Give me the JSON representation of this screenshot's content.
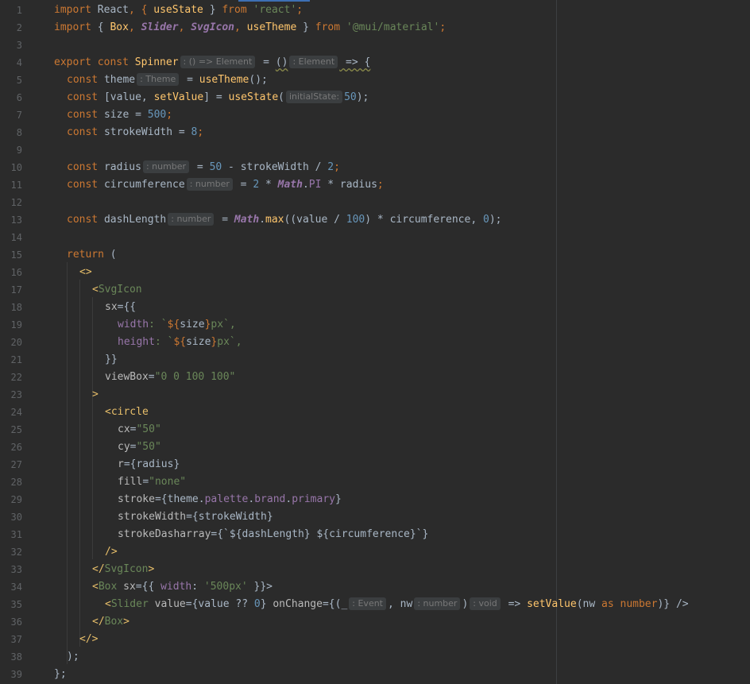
{
  "editor": {
    "language": "tsx",
    "colors": {
      "background": "#2b2b2b",
      "keyword": "#cc7832",
      "function": "#ffc66d",
      "string": "#6a8759",
      "number": "#6897bb",
      "property": "#9876aa",
      "tag": "#e8bf6a",
      "default_text": "#a9b7c6"
    },
    "line_numbers": [
      "1",
      "2",
      "3",
      "4",
      "5",
      "6",
      "7",
      "8",
      "9",
      "10",
      "11",
      "12",
      "13",
      "14",
      "15",
      "16",
      "17",
      "18",
      "19",
      "20",
      "21",
      "22",
      "23",
      "24",
      "25",
      "26",
      "27",
      "28",
      "29",
      "30",
      "31",
      "32",
      "33",
      "34",
      "35",
      "36",
      "37",
      "38",
      "39"
    ],
    "inlay_hints": {
      "spinner_type": ": () => Element",
      "return_type": ": Element",
      "theme_type": ": Theme",
      "initial_state": "initialState:",
      "radius_type": ": number",
      "circumference_type": ": number",
      "dash_type": ": number",
      "event_type": ": Event",
      "nw_type": ": number",
      "void_type": ": void"
    },
    "lines": {
      "l1": {
        "a": "import ",
        "b": "React",
        "c": ", { ",
        "d": "useState",
        "e": " } ",
        "f": "from ",
        "g": "'react'",
        "h": ";"
      },
      "l2": {
        "a": "import ",
        "b": "{ ",
        "c": "Box",
        ",": ", ",
        "d": "Slider",
        "e": "SvgIcon",
        "f": "useTheme",
        "g": " } ",
        "h": "from ",
        "i": "'@mui/material'",
        "j": ";"
      },
      "l4": {
        "a": "export const ",
        "b": "Spinner",
        "c": " = ",
        "d": "()",
        "e": " => {"
      },
      "l5": {
        "a": "const ",
        "b": "theme",
        "c": " = ",
        "d": "useTheme",
        "e": "();"
      },
      "l6": {
        "a": "const ",
        "b": "[value, ",
        "c": "setValue",
        "d": "] = ",
        "e": "useState",
        "f": "(",
        "g": "50",
        "h": ");"
      },
      "l7": {
        "a": "const ",
        "b": "size = ",
        "c": "500",
        "d": ";"
      },
      "l8": {
        "a": "const ",
        "b": "strokeWidth = ",
        "c": "8",
        "d": ";"
      },
      "l10": {
        "a": "const ",
        "b": "radius",
        "c": " = ",
        "d": "50",
        " - ": " - ",
        "e": "strokeWidth / ",
        "f": "2",
        "g": ";"
      },
      "l11": {
        "a": "const ",
        "b": "circumference",
        "c": " = ",
        "d": "2",
        " * ": " * ",
        "e": "Math",
        ".": ".",
        "f": "PI",
        " *r": " * radius",
        "g": ";"
      },
      "l13": {
        "a": "const ",
        "b": "dashLength",
        "c": " = ",
        "d": "Math",
        ".": ".",
        "e": "max",
        "f": "((value / ",
        "g": "100",
        ") *": ") * circumference, ",
        "h": "0",
        "i": ");"
      },
      "l15": {
        "a": "return ",
        "b": "("
      },
      "l16": {
        "a": "<>"
      },
      "l17": {
        "a": "<",
        "b": "SvgIcon"
      },
      "l18": {
        "a": "sx",
        "b": "={{"
      },
      "l19": {
        "a": "width",
        "b": ": `",
        "c": "${",
        "d": "size",
        "e": "}",
        "f": "px",
        "g": "`,"
      },
      "l20": {
        "a": "height",
        "b": ": `",
        "c": "${",
        "d": "size",
        "e": "}",
        "f": "px",
        "g": "`,"
      },
      "l21": {
        "a": "}}"
      },
      "l22": {
        "a": "viewBox",
        "b": "=",
        "c": "\"0 0 100 100\""
      },
      "l23": {
        "a": ">"
      },
      "l24": {
        "a": "<",
        "b": "circle"
      },
      "l25": {
        "a": "cx",
        "b": "=",
        "c": "\"50\""
      },
      "l26": {
        "a": "cy",
        "b": "=",
        "c": "\"50\""
      },
      "l27": {
        "a": "r",
        "b": "={radius}"
      },
      "l28": {
        "a": "fill",
        "b": "=",
        "c": "\"none\""
      },
      "l29": {
        "a": "stroke",
        "b": "={theme.",
        "c": "palette",
        ".": ".",
        "d": "brand",
        "e": "primary",
        "f": "}"
      },
      "l30": {
        "a": "strokeWidth",
        "b": "={strokeWidth}"
      },
      "l31": {
        "a": "strokeDasharray",
        "b": "={`${dashLength} ${circumference}`}"
      },
      "l32": {
        "a": "/>"
      },
      "l33": {
        "a": "</",
        "b": "SvgIcon",
        "c": ">"
      },
      "l34": {
        "a": "<",
        "b": "Box",
        " ": " ",
        "c": "sx",
        "d": "={{ ",
        "e": "width",
        ":": ": ",
        "f": "'500px'",
        "g": " }}>"
      },
      "l35": {
        "a": "<",
        "b": "Slider",
        " ": " ",
        "c": "value",
        "d": "={value ?? ",
        "e": "0",
        "f": "} ",
        "g": "onChange",
        "h": "={(_",
        "i": ", nw",
        "j": ")",
        "k": " => ",
        "l": "setValue",
        "m": "(nw ",
        "n": "as ",
        "o": "number",
        ")": ")} />"
      },
      "l36": {
        "a": "</",
        "b": "Box",
        "c": ">"
      },
      "l37": {
        "a": "</>"
      },
      "l38": {
        "a": ");"
      },
      "l39": {
        "a": "};"
      }
    }
  }
}
